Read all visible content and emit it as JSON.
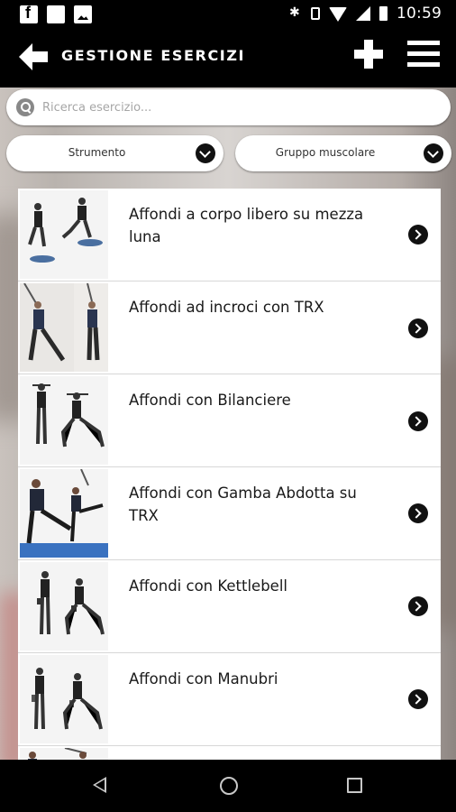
{
  "status_bar": {
    "time": "10:59",
    "left_icons": [
      "facebook-icon",
      "square-notification-icon",
      "image-icon"
    ],
    "right_icons": [
      "bluetooth-icon",
      "vibrate-icon",
      "wifi-icon",
      "signal-icon",
      "battery-icon"
    ]
  },
  "header": {
    "title": "GESTIONE ESERCIZI",
    "back_icon": "arrow-left-icon",
    "add_icon": "plus-icon",
    "menu_icon": "hamburger-menu-icon"
  },
  "search": {
    "placeholder": "Ricerca esercizio...",
    "value": ""
  },
  "filters": {
    "tool_label": "Strumento",
    "muscle_group_label": "Gruppo muscolare"
  },
  "exercises": [
    {
      "name": "Affondi a corpo libero su mezza luna"
    },
    {
      "name": "Affondi ad incroci con TRX"
    },
    {
      "name": "Affondi con Bilanciere"
    },
    {
      "name": "Affondi con Gamba Abdotta su TRX"
    },
    {
      "name": "Affondi con Kettlebell"
    },
    {
      "name": "Affondi con Manubri"
    },
    {
      "name": ""
    }
  ],
  "colors": {
    "header_bg": "#000000",
    "accent": "#111111",
    "list_bg": "#ffffff"
  },
  "nav_bar": {
    "icons": [
      "nav-back-icon",
      "nav-home-icon",
      "nav-recents-icon"
    ]
  }
}
